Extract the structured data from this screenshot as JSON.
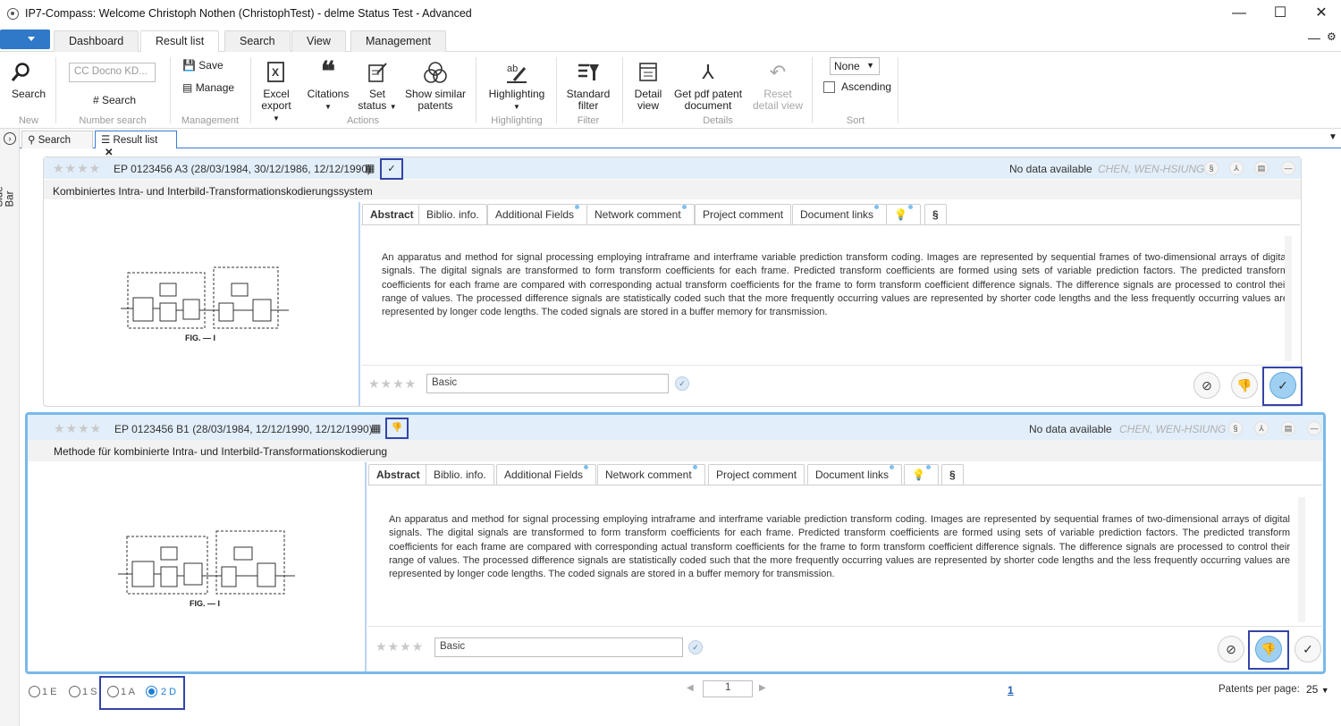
{
  "window": {
    "title": "IP7-Compass: Welcome Christoph Nothen (ChristophTest) - delme Status Test - Advanced",
    "minimize": "—",
    "maximize": "☐",
    "close": "✕"
  },
  "tabs": [
    "Dashboard",
    "Result list",
    "Search",
    "View",
    "Management"
  ],
  "ribbon": {
    "search_label": "Search",
    "group_new": "New",
    "number_input_placeholder": "CC Docno KD...",
    "number_search_button": "Search",
    "group_number_search": "Number search",
    "save": "Save",
    "manage": "Manage",
    "group_management": "Management",
    "excel_export": [
      "Excel",
      "export"
    ],
    "citations": "Citations",
    "set_status": [
      "Set",
      "status"
    ],
    "show_similar": [
      "Show similar",
      "patents"
    ],
    "group_actions": "Actions",
    "highlighting": "Highlighting",
    "group_highlighting": "Highlighting",
    "standard_filter": [
      "Standard",
      "filter"
    ],
    "group_filter": "Filter",
    "detail_view": [
      "Detail",
      "view"
    ],
    "get_pdf": [
      "Get pdf patent",
      "document"
    ],
    "reset_detail": [
      "Reset",
      "detail view"
    ],
    "group_details": "Details",
    "sort_value": "None",
    "ascending": "Ascending",
    "group_sort": "Sort"
  },
  "sidebar": {
    "label": "Side-Bar"
  },
  "doc_tabs": {
    "search": "Search",
    "result_list": "Result list"
  },
  "inner_tabs": [
    "Abstract",
    "Biblio. info.",
    "Additional Fields",
    "Network comment",
    "Project comment",
    "Document links",
    "§"
  ],
  "results": [
    {
      "pnum": "EP 0123456 A3 (28/03/1984, 30/12/1986, 12/12/1990)",
      "status_icon": "✓",
      "nodata": "No data available",
      "inventor": "CHEN, WEN-HSIUNG",
      "title": "Kombiniertes Intra- und Interbild-Transformationskodierungssystem",
      "abstract": "An apparatus and method for signal processing employing intraframe and interframe variable prediction transform coding. Images are represented by sequential frames of two-dimensional arrays of digital signals. The digital signals are transformed to form transform coefficients for each frame. Predicted transform coefficients are formed using sets of variable prediction factors. The predicted transform coefficients for each frame are compared with corresponding actual transform coefficients for the frame to form transform coefficient difference signals. The difference signals are processed to control their range of values. The processed difference signals are statistically coded such that the more frequently occurring values are represented by shorter code lengths and the less frequently occurring values are represented by longer code lengths. The coded signals are stored in a buffer memory for transmission.",
      "rating_value": "Basic",
      "fig_label": "FIG. — I",
      "active_status": "relevant"
    },
    {
      "pnum": "EP 0123456 B1 (28/03/1984, 12/12/1990, 12/12/1990)",
      "status_icon": "👎",
      "nodata": "No data available",
      "inventor": "CHEN, WEN-HSIUNG",
      "title": "Methode für kombinierte Intra- und Interbild-Transformationskodierung",
      "abstract": "An apparatus and method for signal processing employing intraframe and interframe variable prediction transform coding. Images are represented by sequential frames of two-dimensional arrays of digital signals. The digital signals are transformed to form transform coefficients for each frame. Predicted transform coefficients are formed using sets of variable prediction factors. The predicted transform coefficients for each frame are compared with corresponding actual transform coefficients for the frame to form transform coefficient difference signals. The difference signals are processed to control their range of values. The processed difference signals are statistically coded such that the more frequently occurring values are represented by shorter code lengths and the less frequently occurring values are represented by longer code lengths. The coded signals are stored in a buffer memory for transmission.",
      "rating_value": "Basic",
      "fig_label": "FIG. — I",
      "active_status": "not-relevant"
    }
  ],
  "footer": {
    "radios": [
      "1 E",
      "1 S",
      "1 A",
      "2 D"
    ],
    "selected_radio": "2 D",
    "page_input": "1",
    "page_link": "1",
    "per_page_label": "Patents per page:",
    "per_page_value": "25"
  },
  "colors": {
    "accent": "#2f79c8",
    "header_bg": "#e2eef9",
    "highlight_box": "#3444a8",
    "selected_card": "#7ab9ea"
  }
}
